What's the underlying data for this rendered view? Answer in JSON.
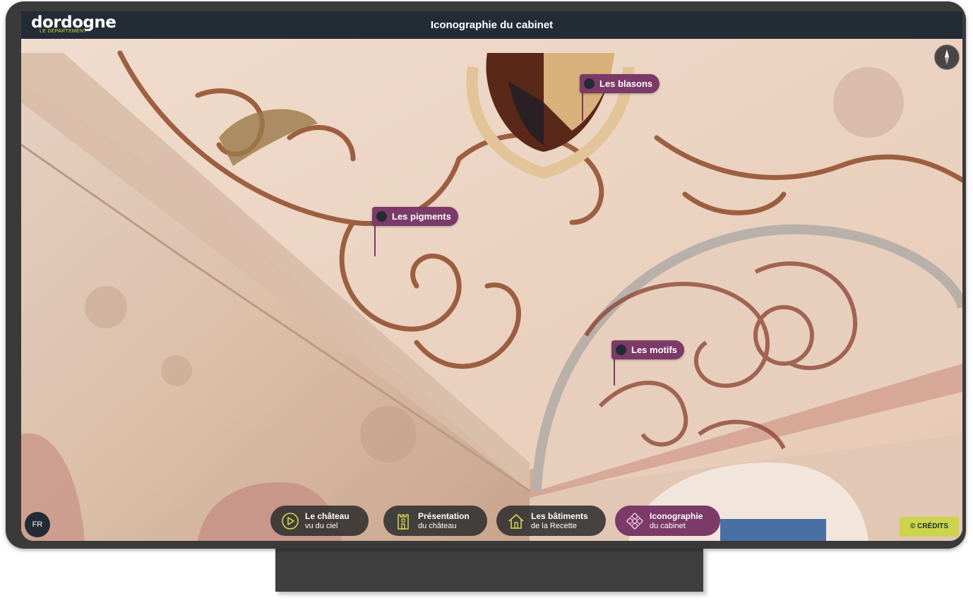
{
  "brand": {
    "name": "dordogne",
    "subtitle": "LE DÉPARTEMENT"
  },
  "header": {
    "title": "Iconographie du cabinet"
  },
  "hotspots": [
    {
      "label": "Les blasons"
    },
    {
      "label": "Les pigments"
    },
    {
      "label": "Les motifs"
    }
  ],
  "language": "FR",
  "nav": [
    {
      "line1": "Le château",
      "line2": "vu du ciel",
      "icon": "play-icon",
      "active": false
    },
    {
      "line1": "Présentation",
      "line2": "du château",
      "icon": "castle-tower-icon",
      "active": false
    },
    {
      "line1": "Les bâtiments",
      "line2": "de la Recette",
      "icon": "house-icon",
      "active": false
    },
    {
      "line1": "Iconographie",
      "line2": "du cabinet",
      "icon": "ornament-icon",
      "active": true
    }
  ],
  "credits": "© CRÉDITS",
  "colors": {
    "header": "#232b35",
    "accent": "#7b3a68",
    "credits": "#cbd44b",
    "icon_accent": "#d6d854"
  }
}
